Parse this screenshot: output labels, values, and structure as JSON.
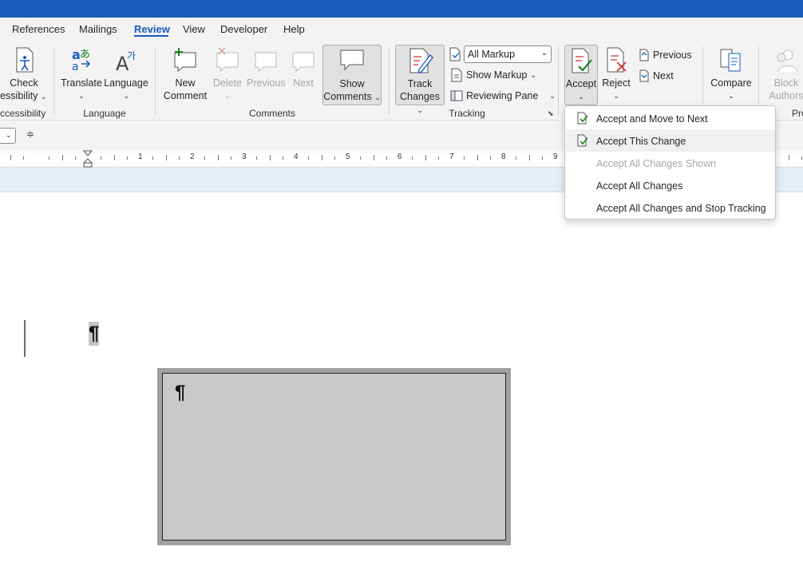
{
  "menu": {
    "tabs": [
      "References",
      "Mailings",
      "Review",
      "View",
      "Developer",
      "Help"
    ],
    "active": "Review"
  },
  "ribbon": {
    "accessibility": {
      "line1": "Check",
      "line2": "ccessibility",
      "group": "ccessibility"
    },
    "language": {
      "translate": "Translate",
      "language": "Language",
      "group": "Language"
    },
    "comments": {
      "new_line1": "New",
      "new_line2": "Comment",
      "delete": "Delete",
      "previous": "Previous",
      "next": "Next",
      "show_line1": "Show",
      "show_line2": "Comments",
      "group": "Comments"
    },
    "tracking": {
      "track_line1": "Track",
      "track_line2": "Changes",
      "markup_value": "All Markup",
      "show_markup": "Show Markup",
      "reviewing_pane": "Reviewing Pane",
      "group": "Tracking"
    },
    "changes": {
      "accept": "Accept",
      "reject": "Reject",
      "previous": "Previous",
      "next": "Next"
    },
    "compare": {
      "compare": "Compare"
    },
    "protect": {
      "block_line1": "Block",
      "block_line2": "Authors",
      "group": "Pro"
    }
  },
  "ruler": {
    "numbers": [
      "1",
      "2",
      "3",
      "4",
      "5",
      "6",
      "7",
      "8",
      "9"
    ]
  },
  "document": {
    "pilcrow1": "¶",
    "pilcrow2": "¶"
  },
  "accept_menu": {
    "items": [
      {
        "label": "Accept and Move to Next",
        "enabled": true
      },
      {
        "label": "Accept This Change",
        "enabled": true
      },
      {
        "label": "Accept All Changes Shown",
        "enabled": false
      },
      {
        "label": "Accept All Changes",
        "enabled": true
      },
      {
        "label": "Accept All Changes and Stop Tracking",
        "enabled": true
      }
    ]
  },
  "colors": {
    "brand": "#185abd",
    "ribbon_bg": "#f3f3f3",
    "accent_red": "#d13438",
    "accent_green": "#107c10"
  }
}
